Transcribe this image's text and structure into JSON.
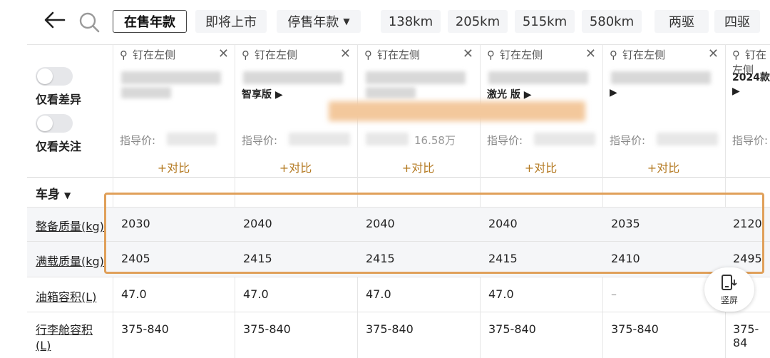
{
  "tabs": [
    {
      "label": "在售年款",
      "active": true
    },
    {
      "label": "即将上市",
      "active": false
    },
    {
      "label": "停售年款",
      "active": false,
      "dropdown": true
    },
    {
      "label": "138km",
      "active": false
    },
    {
      "label": "205km",
      "active": false
    },
    {
      "label": "515km",
      "active": false
    },
    {
      "label": "580km",
      "active": false
    },
    {
      "label": "两驱",
      "active": false
    },
    {
      "label": "四驱",
      "active": false
    }
  ],
  "filters": {
    "only_diff": "仅看差异",
    "only_followed": "仅看关注"
  },
  "columns": [
    {
      "pin_label": "钉在左侧",
      "model_suffix": "",
      "price_label": "指导价:",
      "price_value": "",
      "compare_label": "+对比"
    },
    {
      "pin_label": "钉在左侧",
      "model_suffix": "智享版 ▶",
      "price_label": "指导价:",
      "price_value": "",
      "compare_label": "+对比"
    },
    {
      "pin_label": "钉在左侧",
      "model_suffix": "",
      "price_label": "",
      "price_value": "16.58万",
      "compare_label": "+对比"
    },
    {
      "pin_label": "钉在左侧",
      "model_suffix": "激光 版 ▶",
      "price_label": "指导价:",
      "price_value": "",
      "compare_label": "+对比"
    },
    {
      "pin_label": "钉在左侧",
      "model_suffix": "▶",
      "price_label": "指导价:",
      "price_value": "",
      "compare_label": "+对比"
    },
    {
      "pin_label": "钉在左侧",
      "model_suffix": "2024款",
      "price_label": "指导价:",
      "price_value": "",
      "compare_label": ""
    }
  ],
  "section_title": "车身",
  "rows": [
    {
      "label": "整备质量(kg)",
      "values": [
        "2030",
        "2040",
        "2040",
        "2040",
        "2035",
        "2120"
      ]
    },
    {
      "label": "满载质量(kg)",
      "values": [
        "2405",
        "2415",
        "2415",
        "2415",
        "2410",
        "2495"
      ]
    },
    {
      "label": "油箱容积(L)",
      "values": [
        "47.0",
        "47.0",
        "47.0",
        "47.0",
        "–",
        ""
      ]
    },
    {
      "label": "行李舱容积(L)",
      "values": [
        "375-840",
        "375-840",
        "375-840",
        "375-840",
        "375-840",
        "375-84"
      ]
    }
  ],
  "fab_label": "竖屏",
  "colors": {
    "accent": "#b3781f",
    "highlight": "#e0a05a"
  }
}
